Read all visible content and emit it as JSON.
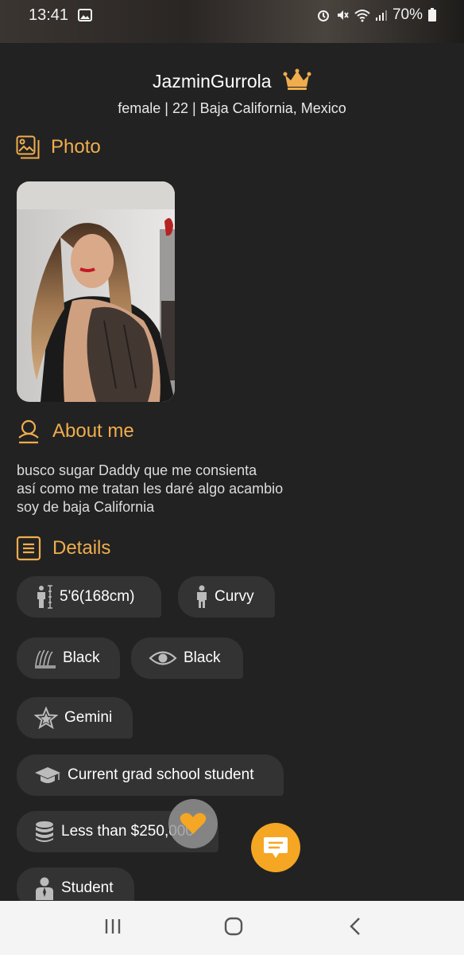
{
  "status_bar": {
    "time": "13:41",
    "battery": "70%"
  },
  "profile": {
    "username": "JazminGurrola",
    "subtitle": "female | 22 | Baja California, Mexico"
  },
  "sections": {
    "photo": "Photo",
    "about": "About me",
    "details": "Details"
  },
  "about_text": [
    "busco sugar Daddy que me consienta",
    "así como me tratan les daré algo acambio",
    "soy de baja California"
  ],
  "details": {
    "height": "5'6(168cm)",
    "body": "Curvy",
    "hair": "Black",
    "eyes": "Black",
    "zodiac": "Gemini",
    "education": "Current grad school student",
    "income": "Less than $250,000",
    "occupation": "Student"
  },
  "colors": {
    "accent": "#f0ad4e",
    "background": "#222222",
    "chip": "#333333"
  }
}
